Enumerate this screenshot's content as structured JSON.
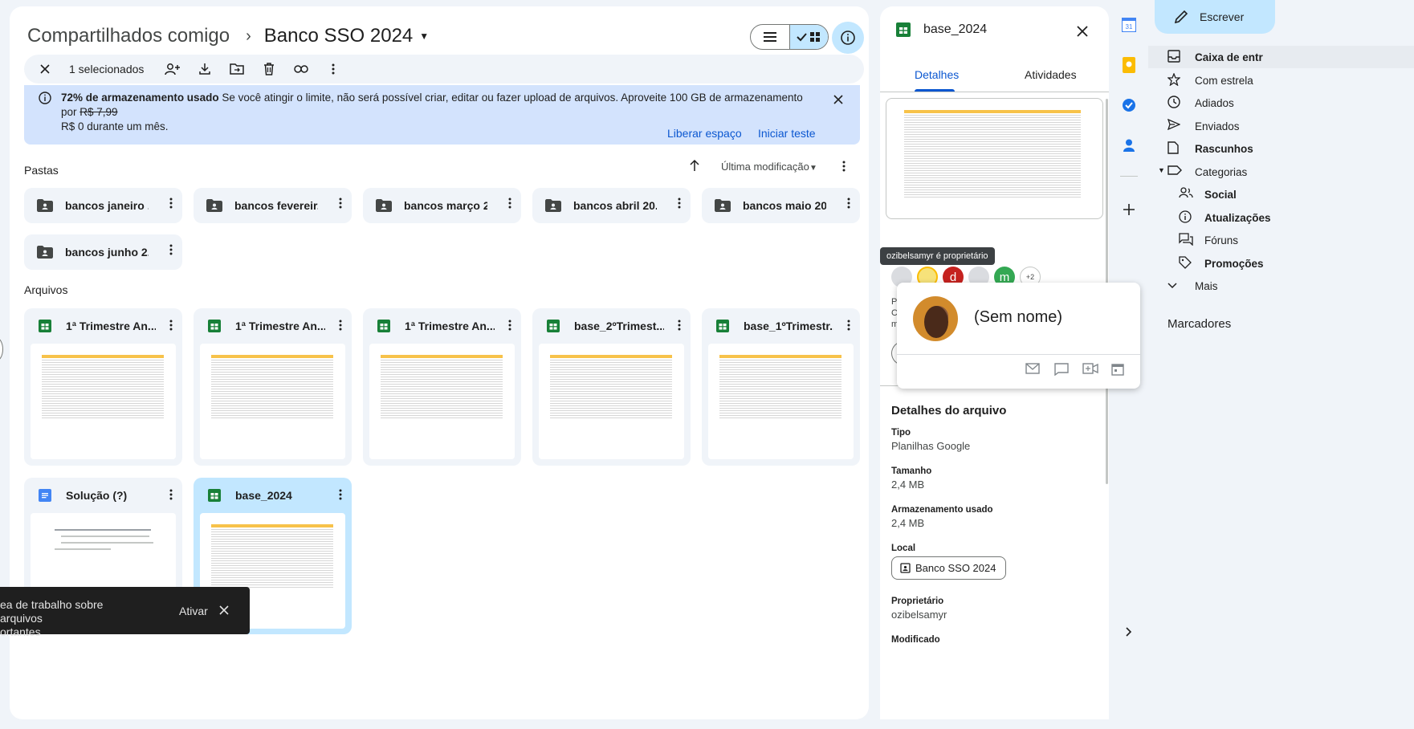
{
  "breadcrumb": {
    "parent": "Compartilhados comigo",
    "current": "Banco SSO 2024"
  },
  "selection": {
    "count_label": "1 selecionados"
  },
  "banner": {
    "bold": "72% de armazenamento usado",
    "text": " Se você atingir o limite, não será possível criar, editar ou fazer upload de arquivos. Aproveite 100 GB de armazenamento por ",
    "old_price": "R$ 7,99",
    "text2": "R$ 0 durante um mês.",
    "action1": "Liberar espaço",
    "action2": "Iniciar teste"
  },
  "sections": {
    "folders": "Pastas",
    "files": "Arquivos",
    "sort_label": "Última modificação"
  },
  "folders": [
    {
      "name": "bancos janeiro ..."
    },
    {
      "name": "bancos fevereir..."
    },
    {
      "name": "bancos março 2..."
    },
    {
      "name": "bancos abril 20..."
    },
    {
      "name": "bancos maio 20..."
    },
    {
      "name": "bancos junho 2..."
    }
  ],
  "files": [
    {
      "name": "1ª Trimestre An...",
      "type": "sheet"
    },
    {
      "name": "1ª Trimestre An...",
      "type": "sheet"
    },
    {
      "name": "1ª Trimestre An...",
      "type": "sheet"
    },
    {
      "name": "base_2ºTrimest...",
      "type": "sheet"
    },
    {
      "name": "base_1ºTrimestr...",
      "type": "sheet"
    },
    {
      "name": "Solução (?)",
      "type": "doc"
    },
    {
      "name": "base_2024",
      "type": "sheet",
      "selected": true
    }
  ],
  "toast": {
    "text": "ea de trabalho sobre arquivos ortantes",
    "line1": "ea de trabalho sobre arquivos",
    "line2": "ortantes",
    "action": "Ativar"
  },
  "details": {
    "title": "base_2024",
    "tabs": [
      "Detalhes",
      "Atividades"
    ],
    "tooltip": "ozibelsamyr é proprietário",
    "avatars": [
      "",
      "",
      "d",
      "",
      "m"
    ],
    "more_count": "+2",
    "section_title": "Detalhes do arquivo",
    "fields": [
      {
        "label": "Tipo",
        "value": "Planilhas Google"
      },
      {
        "label": "Tamanho",
        "value": "2,4 MB"
      },
      {
        "label": "Armazenamento usado",
        "value": "2,4 MB"
      }
    ],
    "location_label": "Local",
    "location_value": "Banco SSO 2024",
    "owner_label": "Proprietário",
    "owner_value": "ozibelsamyr",
    "modified_label": "Modificado"
  },
  "profile_card": {
    "name": "(Sem nome)"
  },
  "gmail": {
    "compose": "Escrever",
    "items": [
      {
        "label": "Caixa de entr",
        "icon": "inbox-icon",
        "bold": true,
        "active": true
      },
      {
        "label": "Com estrela",
        "icon": "star-icon"
      },
      {
        "label": "Adiados",
        "icon": "clock-icon"
      },
      {
        "label": "Enviados",
        "icon": "send-icon"
      },
      {
        "label": "Rascunhos",
        "icon": "draft-icon",
        "bold": true
      },
      {
        "label": "Categorias",
        "icon": "label-icon"
      },
      {
        "label": "Social",
        "icon": "people-icon",
        "bold": true,
        "sub": true
      },
      {
        "label": "Atualizações",
        "icon": "info-icon",
        "bold": true,
        "sub": true
      },
      {
        "label": "Fóruns",
        "icon": "forum-icon",
        "sub": true
      },
      {
        "label": "Promoções",
        "icon": "tag-icon",
        "bold": true,
        "sub": true
      },
      {
        "label": "Mais",
        "icon": "chevron-down-icon"
      }
    ],
    "labels_title": "Marcadores"
  },
  "colors": {
    "accent": "#0b57d0",
    "selected": "#c2e7ff",
    "sheets_green": "#188038",
    "docs_blue": "#4285f4"
  }
}
